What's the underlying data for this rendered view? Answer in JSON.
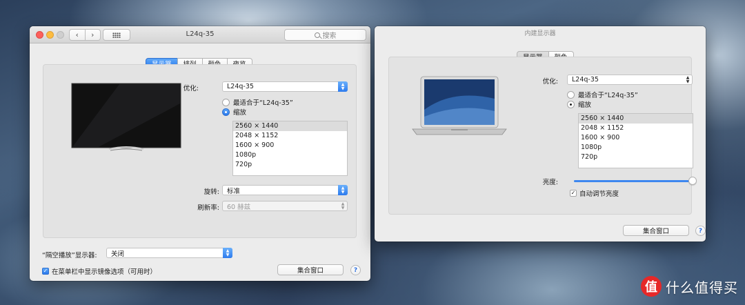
{
  "left_window": {
    "title": "L24q-35",
    "search_placeholder": "搜索",
    "nav_back": "‹",
    "nav_forward": "›",
    "tabs": [
      {
        "label": "显示器",
        "active": true
      },
      {
        "label": "排列",
        "active": false
      },
      {
        "label": "颜色",
        "active": false
      },
      {
        "label": "夜览",
        "active": false
      }
    ],
    "optimize_label": "优化:",
    "optimize_value": "L24q-35",
    "radio_best": "最适合于“L24q-35”",
    "radio_scaled": "缩放",
    "resolutions": [
      "2560 × 1440",
      "2048 × 1152",
      "1600 × 900",
      "1080p",
      "720p"
    ],
    "selected_resolution": 0,
    "rotation_label": "旋转:",
    "rotation_value": "标准",
    "refresh_label": "刷新率:",
    "refresh_value": "60 赫兹",
    "airplay_label": "“隔空播放”显示器:",
    "airplay_value": "关闭",
    "mirror_checkbox": "在菜单栏中显示镜像选项（可用时）",
    "mirror_checked": true,
    "gather_button": "集合窗口",
    "help": "?"
  },
  "right_window": {
    "title": "内建显示器",
    "tabs": [
      {
        "label": "显示器",
        "active": true
      },
      {
        "label": "颜色",
        "active": false
      }
    ],
    "optimize_label": "优化:",
    "optimize_value": "L24q-35",
    "radio_best": "最适合于“L24q-35”",
    "radio_scaled": "缩放",
    "resolutions": [
      "2560 × 1440",
      "2048 × 1152",
      "1600 × 900",
      "1080p",
      "720p"
    ],
    "selected_resolution": 0,
    "brightness_label": "亮度:",
    "brightness_level": 1.0,
    "auto_brightness": "自动调节亮度",
    "auto_brightness_checked": true,
    "gather_button": "集合窗口",
    "help": "?"
  },
  "watermark": {
    "badge": "值",
    "text": "什么值得买"
  },
  "colors": {
    "accent_blue": "#2a78ec",
    "close_red": "#fc605c",
    "minimize_yellow": "#fdbc40"
  }
}
